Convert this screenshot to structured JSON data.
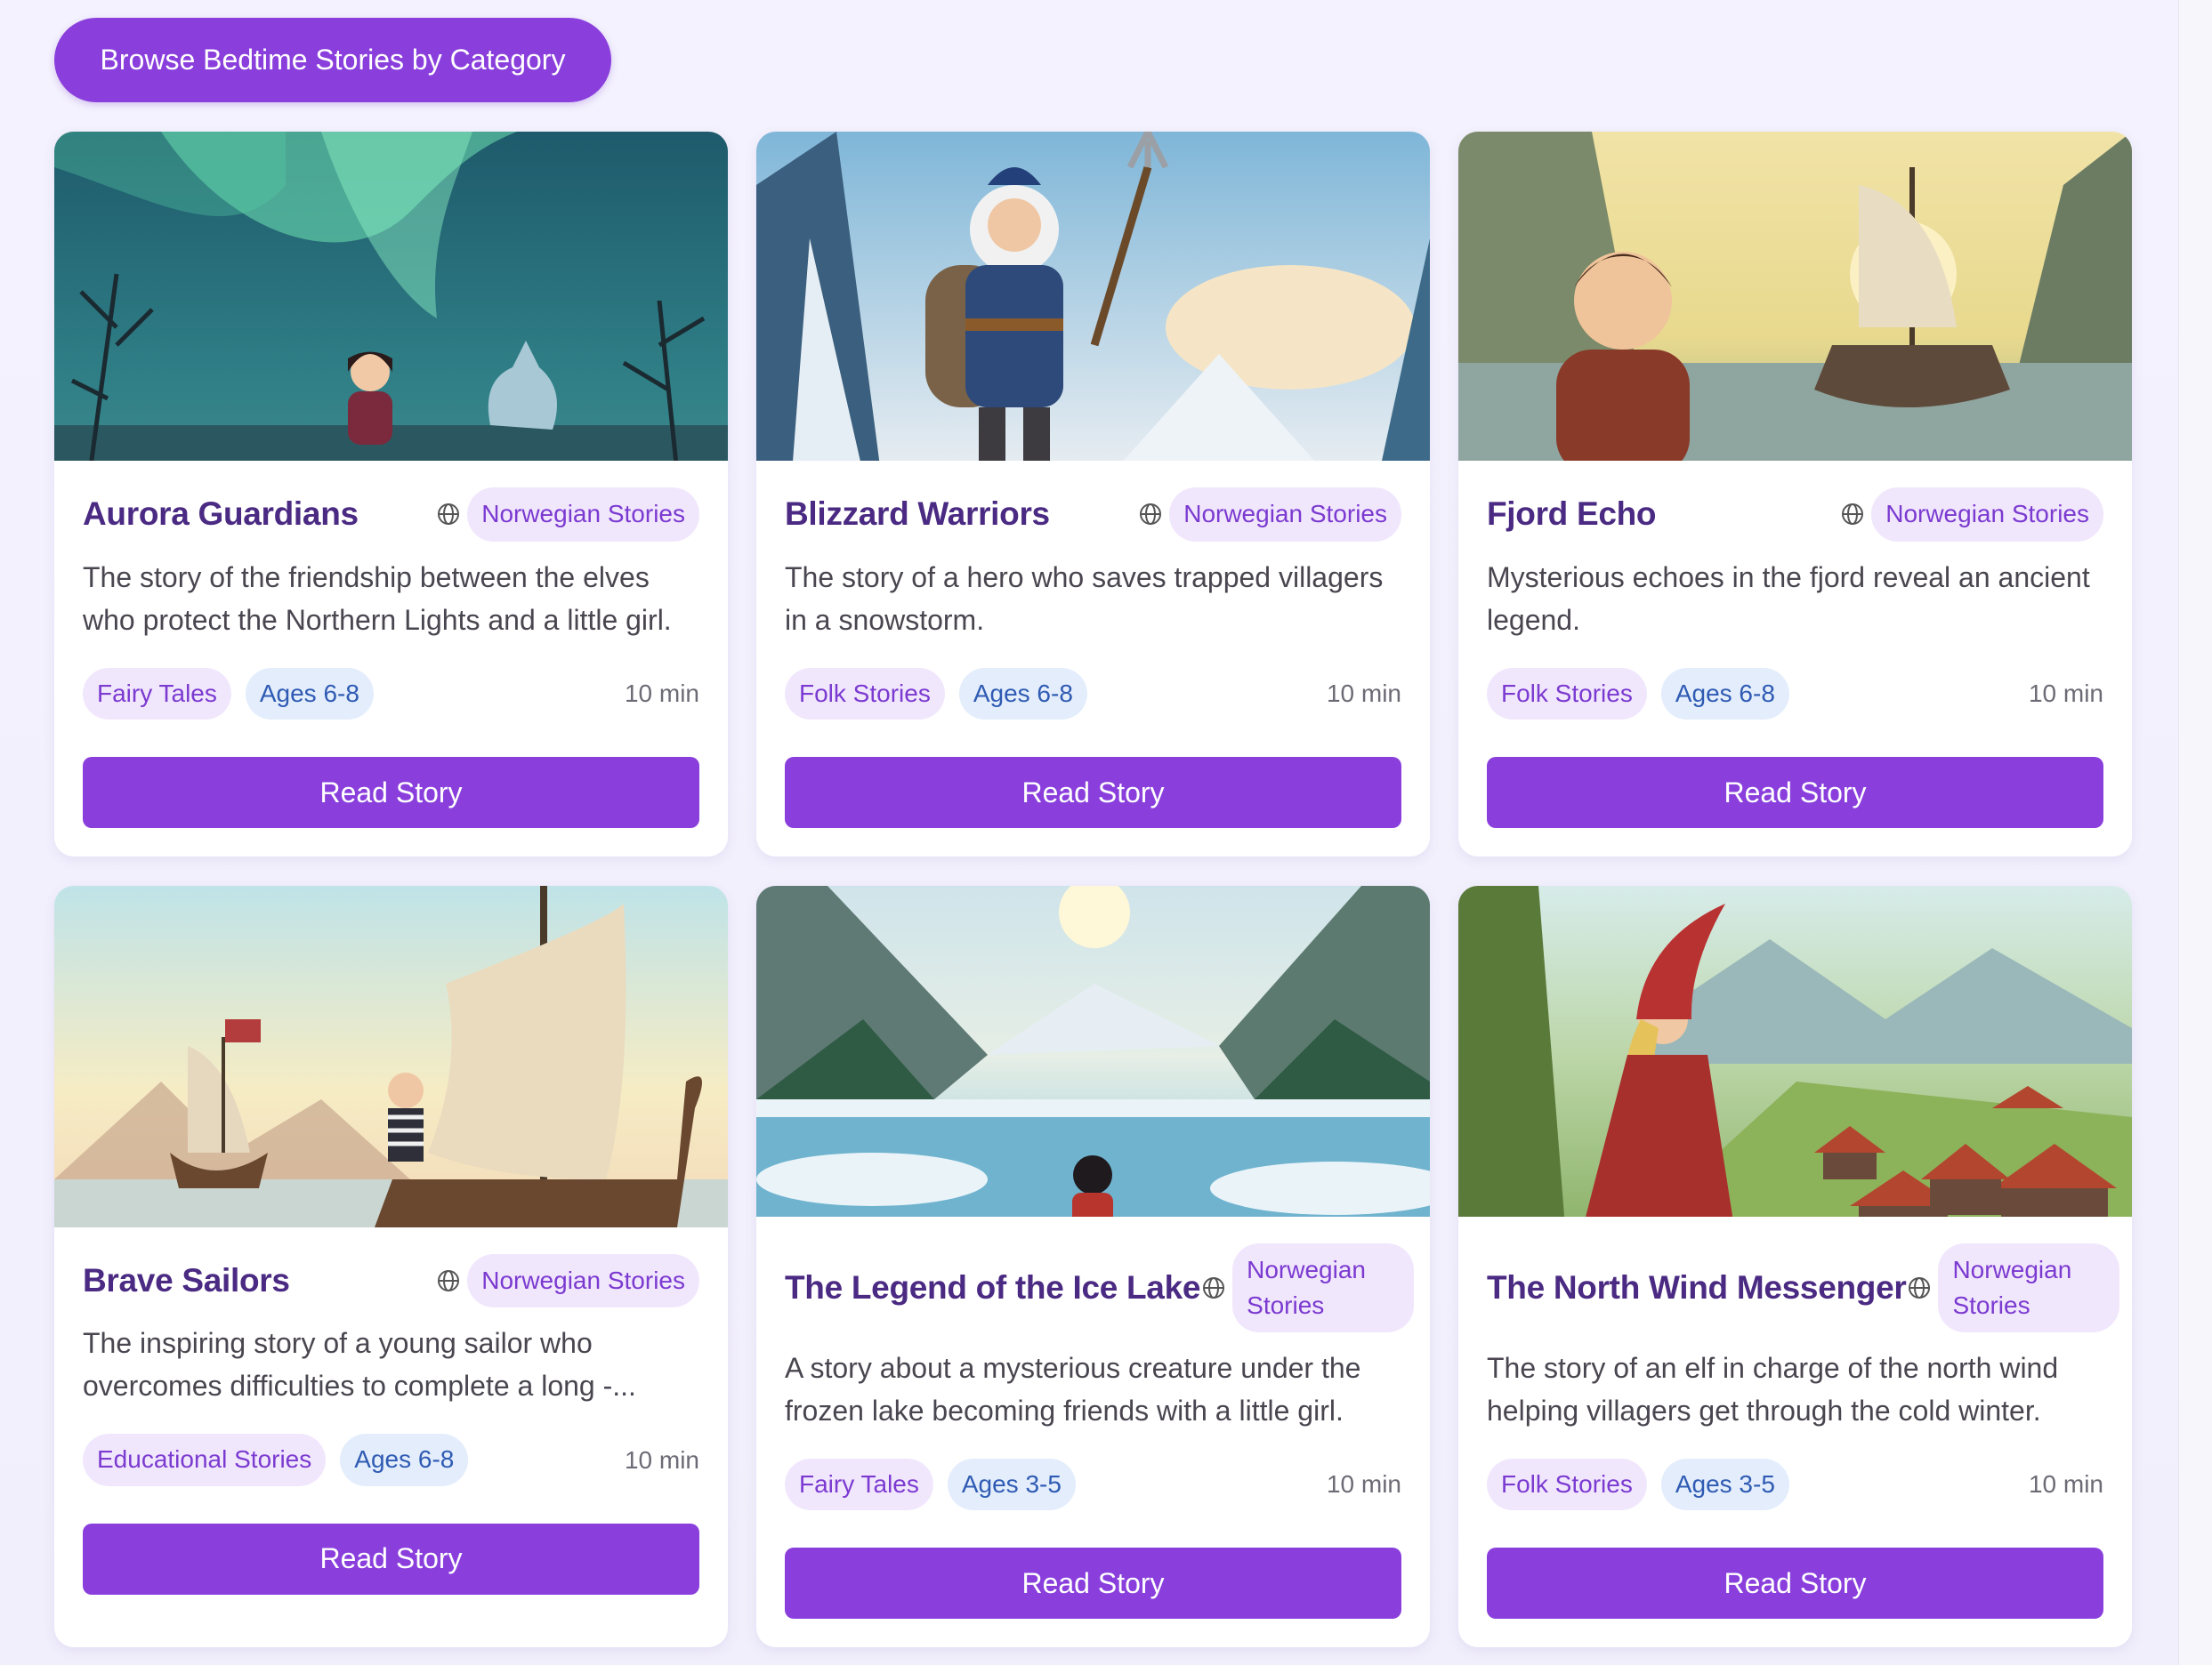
{
  "header": {
    "browse_label": "Browse Bedtime Stories by Category"
  },
  "cards": [
    {
      "title": "Aurora Guardians",
      "origin": "Norwegian Stories",
      "description": "The story of the friendship between the elves who protect the Northern Lights and a little girl.",
      "category": "Fairy Tales",
      "age": "Ages 6-8",
      "duration": "10 min",
      "button": "Read Story"
    },
    {
      "title": "Blizzard Warriors",
      "origin": "Norwegian Stories",
      "description": "The story of a hero who saves trapped villagers in a snowstorm.",
      "category": "Folk Stories",
      "age": "Ages 6-8",
      "duration": "10 min",
      "button": "Read Story"
    },
    {
      "title": "Fjord Echo",
      "origin": "Norwegian Stories",
      "description": "Mysterious echoes in the fjord reveal an ancient legend.",
      "category": "Folk Stories",
      "age": "Ages 6-8",
      "duration": "10 min",
      "button": "Read Story"
    },
    {
      "title": "Brave Sailors",
      "origin": "Norwegian Stories",
      "description": "The inspiring story of a young sailor who overcomes difficulties to complete a long -...",
      "category": "Educational Stories",
      "age": "Ages 6-8",
      "duration": "10 min",
      "button": "Read Story"
    },
    {
      "title": "The Legend of the Ice Lake",
      "origin": "Norwegian Stories",
      "description": "A story about a mysterious creature under the frozen lake becoming friends with a little girl.",
      "category": "Fairy Tales",
      "age": "Ages 3-5",
      "duration": "10 min",
      "button": "Read Story"
    },
    {
      "title": "The North Wind Messenger",
      "origin": "Norwegian Stories",
      "description": "The story of an elf in charge of the north wind helping villagers get through the cold winter.",
      "category": "Folk Stories",
      "age": "Ages 3-5",
      "duration": "10 min",
      "button": "Read Story"
    }
  ],
  "colors": {
    "accent": "#8a3fdd",
    "title": "#4a2a82",
    "category_bg": "#f1e7fd",
    "age_bg": "#e3edfc"
  },
  "icons": {
    "origin": "globe-icon"
  }
}
